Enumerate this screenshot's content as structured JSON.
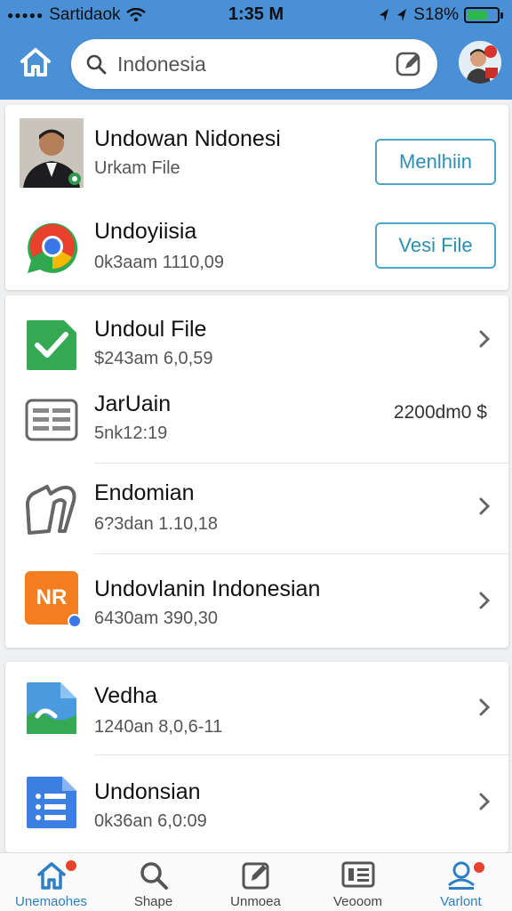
{
  "status_bar": {
    "carrier": "Sartidaok",
    "time": "1:35 M",
    "battery": "S18%"
  },
  "header": {
    "search": {
      "value": "Indonesia",
      "placeholder": "Indonesia"
    }
  },
  "section1": [
    {
      "title": "Undowan Nidonesi",
      "subtitle": "Urkam File",
      "button": "Menlhiin",
      "icon": "person-photo"
    },
    {
      "title": "Undoyiisia",
      "subtitle": "0k3aam 1110,09",
      "button": "Vesi File",
      "icon": "chrome-chat-icon"
    }
  ],
  "section2": [
    {
      "title": "Undoul File",
      "subtitle": "$243am 6,0,59",
      "icon": "green-check-icon",
      "trailing": "chevron"
    },
    {
      "title": "JarUain",
      "subtitle": "5nk12:19",
      "icon": "list-doc-icon",
      "amount": "2200dm0 $"
    },
    {
      "title": "Endomian",
      "subtitle": "6?3dan 1.10,18",
      "icon": "outline-shape-icon",
      "trailing": "chevron"
    },
    {
      "title": "Undovlanin Indonesian",
      "subtitle": "6430am 390,30",
      "icon": "nr-badge-icon",
      "badge_text": "NR",
      "trailing": "chevron"
    }
  ],
  "section3": [
    {
      "title": "Vedha",
      "subtitle": "1240an 8,0,6-11",
      "icon": "image-file-icon",
      "trailing": "chevron"
    },
    {
      "title": "Undonsian",
      "subtitle": "0k36an 6,0:09",
      "icon": "docs-icon",
      "trailing": "chevron"
    }
  ],
  "tabbar": [
    {
      "label": "Unemaohes",
      "icon": "home-icon",
      "active": true
    },
    {
      "label": "Shape",
      "icon": "search-icon",
      "active": false
    },
    {
      "label": "Unmoea",
      "icon": "edit-icon",
      "active": false
    },
    {
      "label": "Veooom",
      "icon": "news-icon",
      "active": false
    },
    {
      "label": "Varlont",
      "icon": "profile-icon",
      "active": true
    }
  ],
  "colors": {
    "header": "#4a90d6",
    "accent": "#2c8fb2",
    "notification": "#e8412c"
  }
}
